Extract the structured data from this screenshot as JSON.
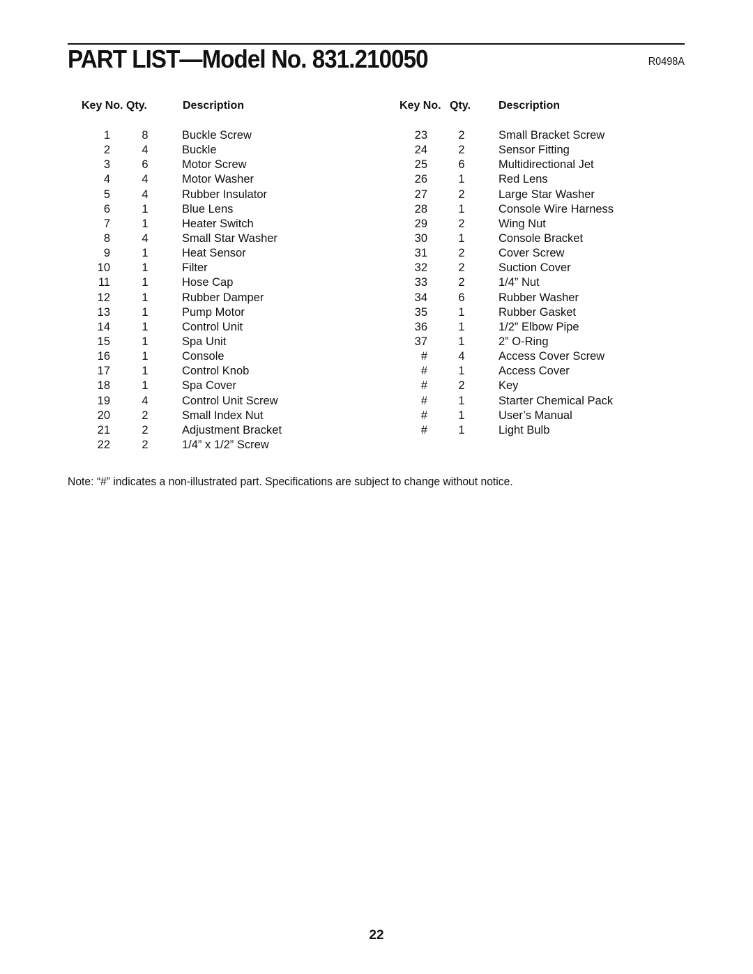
{
  "header": {
    "title": "PART LIST—Model No. 831.210050",
    "doc_id": "R0498A"
  },
  "columns": {
    "key": "Key No.",
    "qty": "Qty.",
    "description": "Description"
  },
  "parts_left": [
    {
      "key": "1",
      "qty": "8",
      "description": "Buckle Screw"
    },
    {
      "key": "2",
      "qty": "4",
      "description": "Buckle"
    },
    {
      "key": "3",
      "qty": "6",
      "description": "Motor Screw"
    },
    {
      "key": "4",
      "qty": "4",
      "description": "Motor Washer"
    },
    {
      "key": "5",
      "qty": "4",
      "description": "Rubber Insulator"
    },
    {
      "key": "6",
      "qty": "1",
      "description": "Blue Lens"
    },
    {
      "key": "7",
      "qty": "1",
      "description": "Heater Switch"
    },
    {
      "key": "8",
      "qty": "4",
      "description": "Small Star Washer"
    },
    {
      "key": "9",
      "qty": "1",
      "description": "Heat Sensor"
    },
    {
      "key": "10",
      "qty": "1",
      "description": "Filter"
    },
    {
      "key": "11",
      "qty": "1",
      "description": "Hose Cap"
    },
    {
      "key": "12",
      "qty": "1",
      "description": "Rubber Damper"
    },
    {
      "key": "13",
      "qty": "1",
      "description": "Pump Motor"
    },
    {
      "key": "14",
      "qty": "1",
      "description": "Control Unit"
    },
    {
      "key": "15",
      "qty": "1",
      "description": "Spa Unit"
    },
    {
      "key": "16",
      "qty": "1",
      "description": "Console"
    },
    {
      "key": "17",
      "qty": "1",
      "description": "Control Knob"
    },
    {
      "key": "18",
      "qty": "1",
      "description": "Spa Cover"
    },
    {
      "key": "19",
      "qty": "4",
      "description": "Control Unit Screw"
    },
    {
      "key": "20",
      "qty": "2",
      "description": "Small Index Nut"
    },
    {
      "key": "21",
      "qty": "2",
      "description": "Adjustment Bracket"
    },
    {
      "key": "22",
      "qty": "2",
      "description": "1/4” x 1/2” Screw"
    }
  ],
  "parts_right": [
    {
      "key": "23",
      "qty": "2",
      "description": "Small Bracket Screw"
    },
    {
      "key": "24",
      "qty": "2",
      "description": "Sensor Fitting"
    },
    {
      "key": "25",
      "qty": "6",
      "description": "Multidirectional Jet"
    },
    {
      "key": "26",
      "qty": "1",
      "description": "Red Lens"
    },
    {
      "key": "27",
      "qty": "2",
      "description": "Large Star Washer"
    },
    {
      "key": "28",
      "qty": "1",
      "description": "Console Wire Harness"
    },
    {
      "key": "29",
      "qty": "2",
      "description": "Wing Nut"
    },
    {
      "key": "30",
      "qty": "1",
      "description": "Console Bracket"
    },
    {
      "key": "31",
      "qty": "2",
      "description": "Cover Screw"
    },
    {
      "key": "32",
      "qty": "2",
      "description": "Suction Cover"
    },
    {
      "key": "33",
      "qty": "2",
      "description": "1/4” Nut"
    },
    {
      "key": "34",
      "qty": "6",
      "description": "Rubber Washer"
    },
    {
      "key": "35",
      "qty": "1",
      "description": "Rubber Gasket"
    },
    {
      "key": "36",
      "qty": "1",
      "description": "1/2” Elbow Pipe"
    },
    {
      "key": "37",
      "qty": "1",
      "description": "2” O-Ring"
    },
    {
      "key": "#",
      "qty": "4",
      "description": "Access Cover Screw"
    },
    {
      "key": "#",
      "qty": "1",
      "description": "Access Cover"
    },
    {
      "key": "#",
      "qty": "2",
      "description": "Key"
    },
    {
      "key": "#",
      "qty": "1",
      "description": "Starter Chemical Pack"
    },
    {
      "key": "#",
      "qty": "1",
      "description": "User’s Manual"
    },
    {
      "key": "#",
      "qty": "1",
      "description": "Light Bulb"
    }
  ],
  "note": "Note: “#” indicates a non-illustrated part. Specifications are subject to change without notice.",
  "page_number": "22"
}
